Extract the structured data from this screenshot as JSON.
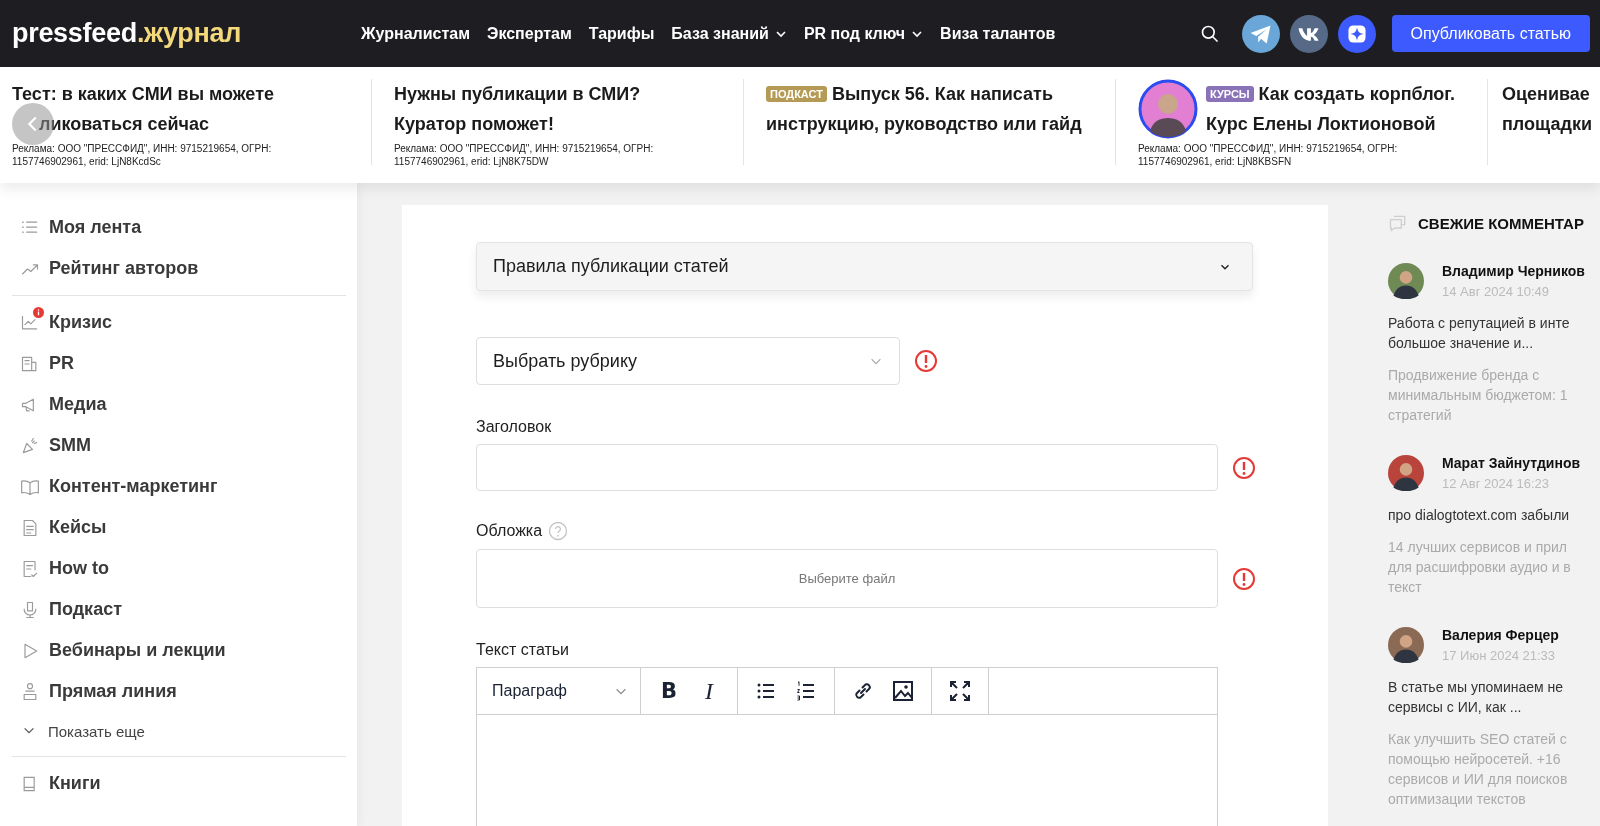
{
  "header": {
    "logo": {
      "main": "pressfeed",
      "accent": ".журнал"
    },
    "nav": [
      {
        "label": "Журналистам",
        "caret": false
      },
      {
        "label": "Экспертам",
        "caret": false
      },
      {
        "label": "Тарифы",
        "caret": false
      },
      {
        "label": "База знаний",
        "caret": true
      },
      {
        "label": "PR под ключ",
        "caret": true
      },
      {
        "label": "Виза талантов",
        "caret": false
      }
    ],
    "publish_button": "Опубликовать статью"
  },
  "ads": [
    {
      "lines": [
        "Тест: в каких СМИ вы можете",
        "ликоваться сейчас"
      ],
      "avatar": false,
      "disclaimer": "Реклама: ООО \"ПРЕССФИД\", ИНН: 9715219654, ОГРН: 1157746902961, erid: LjN8KcdSc"
    },
    {
      "lines": [
        "Нужны публикации в СМИ?",
        "Куратор поможет!"
      ],
      "avatar": false,
      "disclaimer": "Реклама: ООО \"ПРЕССФИД\", ИНН: 9715219654, ОГРН: 1157746902961, erid: LjN8K75DW"
    },
    {
      "tag": {
        "label": "ПОДКАСТ",
        "color": "#b59a55"
      },
      "lines": [
        "Выпуск 56. Как написать",
        "инструкцию, руководство или гайд"
      ],
      "avatar": false
    },
    {
      "tag": {
        "label": "КУРСЫ",
        "color": "#8a72b8"
      },
      "lines": [
        "Как создать корпблог.",
        "Курс Елены Локтионовой"
      ],
      "avatar": true,
      "disclaimer": "Реклама: ООО \"ПРЕССФИД\", ИНН: 9715219654, ОГРН: 1157746902961, erid: LjN8KBSFN"
    },
    {
      "lines": [
        "Оценивае",
        "площадки"
      ],
      "avatar": false
    }
  ],
  "sidebar": {
    "groups": [
      [
        {
          "label": "Моя лента",
          "alert": false
        },
        {
          "label": "Рейтинг авторов",
          "alert": false
        }
      ],
      [
        {
          "label": "Кризис",
          "alert": true
        },
        {
          "label": "PR",
          "alert": false
        },
        {
          "label": "Медиа",
          "alert": false
        },
        {
          "label": "SMM",
          "alert": false
        },
        {
          "label": "Контент-маркетинг",
          "alert": false
        },
        {
          "label": "Кейсы",
          "alert": false
        },
        {
          "label": "How to",
          "alert": false
        },
        {
          "label": "Подкаст",
          "alert": false
        },
        {
          "label": "Вебинары и лекции",
          "alert": false
        },
        {
          "label": "Прямая линия",
          "alert": false
        }
      ]
    ],
    "show_more": "Показать еще",
    "footer_items": [
      {
        "label": "Книги",
        "alert": false
      }
    ]
  },
  "form": {
    "rules": {
      "label": "Правила публикации статей",
      "expanded": false
    },
    "category": {
      "placeholder": "Выбрать рубрику",
      "error": true
    },
    "title": {
      "label": "Заголовок",
      "error": true
    },
    "cover": {
      "label": "Обложка",
      "button": "Выберите файл",
      "error": true
    },
    "body": {
      "label": "Текст статьи",
      "format": "Параграф",
      "tool_groups": [
        [
          {
            "kind": "bold",
            "label": "B"
          },
          {
            "kind": "italic",
            "label": "I"
          }
        ],
        [
          {
            "kind": "bullets"
          },
          {
            "kind": "numbers"
          }
        ],
        [
          {
            "kind": "link"
          },
          {
            "kind": "image"
          }
        ],
        [
          {
            "kind": "fullscreen"
          }
        ]
      ]
    }
  },
  "comments": {
    "title": "СВЕЖИЕ КОММЕНТАР",
    "items": [
      {
        "author": "Владимир Черников",
        "date": "14 Авг 2024 10:49",
        "text": [
          "Работа с репутацией в инте",
          "большое значение и..."
        ],
        "article": [
          "Продвижение бренда с",
          "минимальным бюджетом: 1",
          "стратегий"
        ]
      },
      {
        "author": "Марат Зайнутдинов",
        "date": "12 Авг 2024 16:23",
        "text": [
          "про dialogtotext.com забыли"
        ],
        "article": [
          "14 лучших сервисов и прил",
          "для расшифровки аудио и в",
          "текст"
        ]
      },
      {
        "author": "Валерия Ферцер",
        "date": "17 Июн 2024 21:33",
        "text": [
          "В статье мы упоминаем не",
          "сервисы с ИИ, как ..."
        ],
        "article": [
          "Как улучшить SEO статей с",
          "помощью нейросетей. +16",
          "сервисов и ИИ для поисков",
          "оптимизации текстов"
        ]
      }
    ]
  }
}
